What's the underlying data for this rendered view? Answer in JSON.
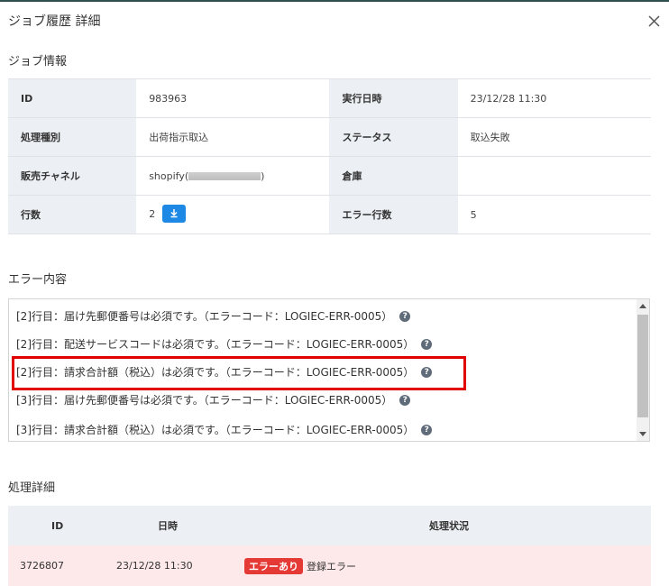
{
  "modal": {
    "title": "ジョブ履歴 詳細"
  },
  "job_info": {
    "section_title": "ジョブ情報",
    "rows": [
      {
        "label_left": "ID",
        "value_left": "983963",
        "label_right": "実行日時",
        "value_right": "23/12/28 11:30"
      },
      {
        "label_left": "処理種別",
        "value_left": "出荷指示取込",
        "label_right": "ステータス",
        "value_right": "取込失敗"
      },
      {
        "label_left": "販売チャネル",
        "value_left": "shopify(",
        "value_left_suffix": ")",
        "label_right": "倉庫",
        "value_right": ""
      },
      {
        "label_left": "行数",
        "value_left": "2",
        "label_right": "エラー行数",
        "value_right": "5"
      }
    ]
  },
  "errors": {
    "section_title": "エラー内容",
    "lines": [
      "[2]行目：届け先郵便番号は必須です。（エラーコード：LOGIEC-ERR-0005）",
      "[2]行目：配送サービスコードは必須です。（エラーコード：LOGIEC-ERR-0005）",
      "[2]行目：請求合計額（税込）は必須です。（エラーコード：LOGIEC-ERR-0005）",
      "[3]行目：届け先郵便番号は必須です。（エラーコード：LOGIEC-ERR-0005）",
      "[3]行目：請求合計額（税込）は必須です。（エラーコード：LOGIEC-ERR-0005）"
    ],
    "help_glyph": "?"
  },
  "process_detail": {
    "section_title": "処理詳細",
    "headers": {
      "id": "ID",
      "datetime": "日時",
      "status": "処理状況"
    },
    "rows": [
      {
        "id": "3726807",
        "datetime": "23/12/28 11:30",
        "badge": "エラーあり",
        "status": "登録エラー"
      }
    ]
  },
  "colors": {
    "accent_blue": "#1e88e5",
    "error_red": "#e53935",
    "highlight_red": "#e00000",
    "error_row_bg": "#fde8ea"
  },
  "icons": {
    "close": "close-icon",
    "download": "download-icon",
    "help": "help-icon"
  }
}
